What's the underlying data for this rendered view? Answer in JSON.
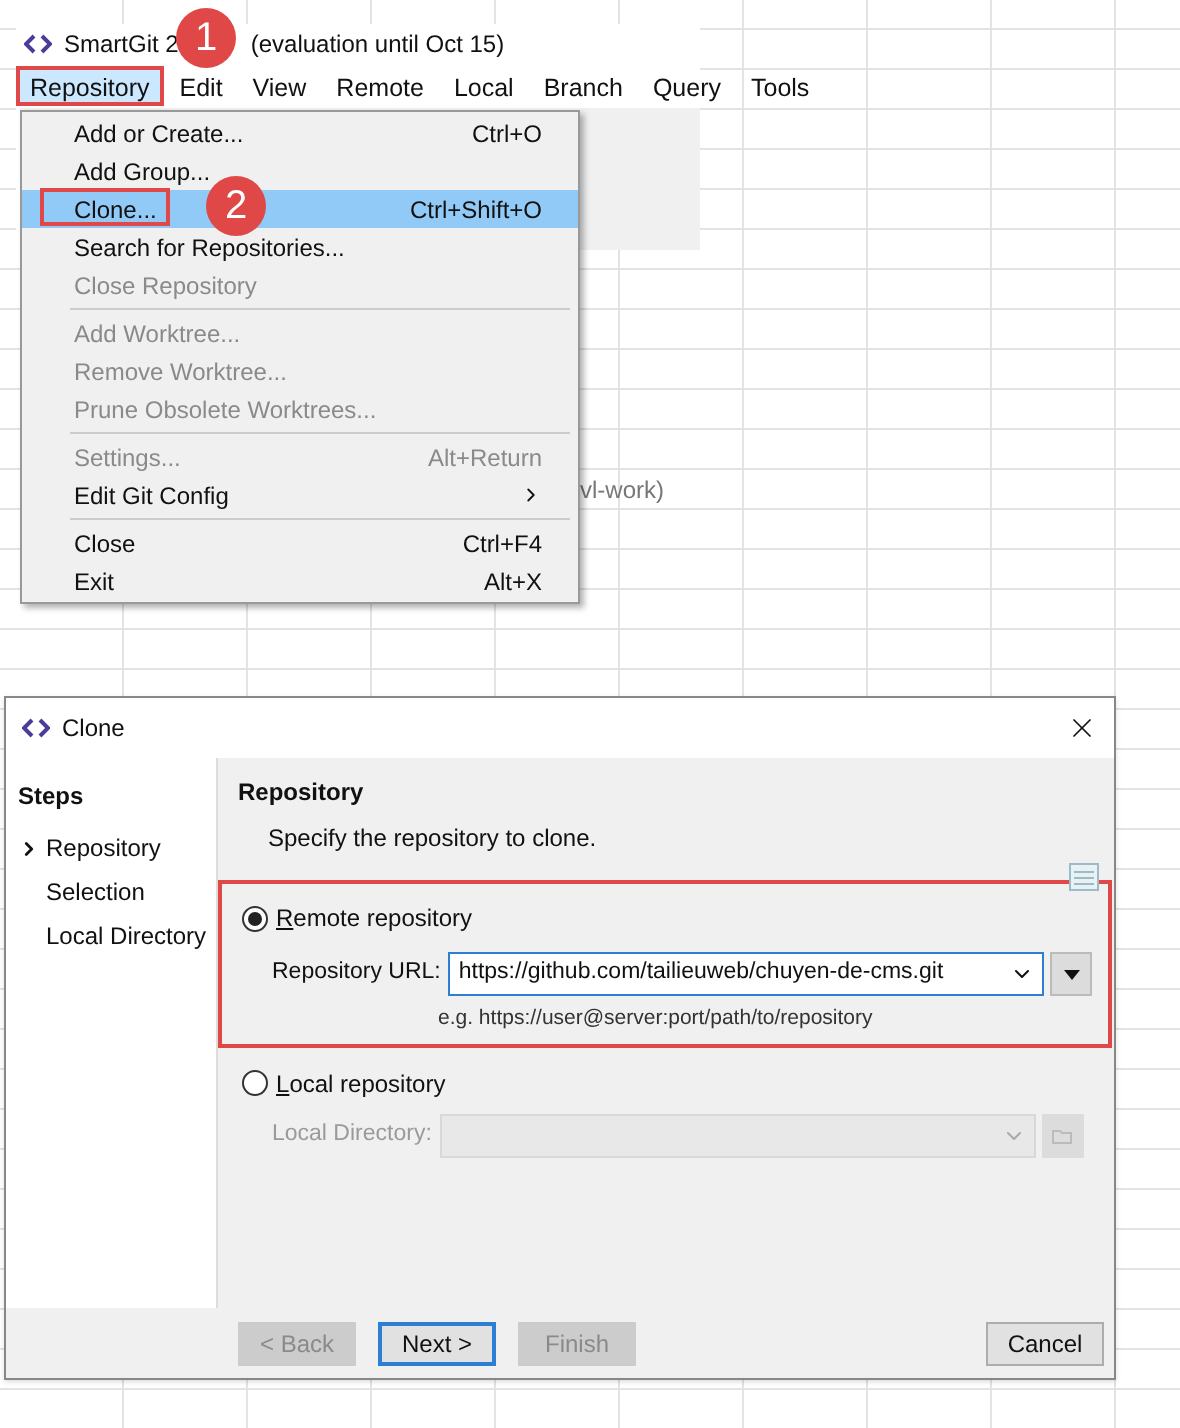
{
  "app_window": {
    "title": "SmartGit 2",
    "title_rest": "(evaluation until Oct 15)",
    "menu_bar": [
      {
        "label": "Repository",
        "selected": true
      },
      {
        "label": "Edit",
        "selected": false
      },
      {
        "label": "View",
        "selected": false
      },
      {
        "label": "Remote",
        "selected": false
      },
      {
        "label": "Local",
        "selected": false
      },
      {
        "label": "Branch",
        "selected": false
      },
      {
        "label": "Query",
        "selected": false
      },
      {
        "label": "Tools",
        "selected": false
      }
    ],
    "background_text": "vl-work)"
  },
  "menu": {
    "items": [
      {
        "kind": "item",
        "label": "Add or Create...",
        "shortcut": "Ctrl+O",
        "disabled": false,
        "selected": false
      },
      {
        "kind": "item",
        "label": "Add Group...",
        "disabled": false,
        "selected": false
      },
      {
        "kind": "item",
        "label": "Clone...",
        "shortcut": "Ctrl+Shift+O",
        "disabled": false,
        "selected": true
      },
      {
        "kind": "item",
        "label": "Search for Repositories...",
        "disabled": false,
        "selected": false
      },
      {
        "kind": "item",
        "label": "Close Repository",
        "disabled": true,
        "selected": false
      },
      {
        "kind": "separator"
      },
      {
        "kind": "item",
        "label": "Add Worktree...",
        "disabled": true,
        "selected": false
      },
      {
        "kind": "item",
        "label": "Remove Worktree...",
        "disabled": true,
        "selected": false
      },
      {
        "kind": "item",
        "label": "Prune Obsolete Worktrees...",
        "disabled": true,
        "selected": false
      },
      {
        "kind": "separator"
      },
      {
        "kind": "item",
        "label": "Settings...",
        "shortcut": "Alt+Return",
        "disabled": true,
        "selected": false
      },
      {
        "kind": "submenu",
        "label": "Edit Git Config",
        "disabled": false,
        "selected": false
      },
      {
        "kind": "separator"
      },
      {
        "kind": "item",
        "label": "Close",
        "shortcut": "Ctrl+F4",
        "disabled": false,
        "selected": false
      },
      {
        "kind": "item",
        "label": "Exit",
        "shortcut": "Alt+X",
        "disabled": false,
        "selected": false
      }
    ]
  },
  "callouts": [
    {
      "number": "1"
    },
    {
      "number": "2"
    }
  ],
  "dialog": {
    "title": "Clone",
    "steps_heading": "Steps",
    "steps": [
      {
        "label": "Repository",
        "selected": true
      },
      {
        "label": "Selection",
        "selected": false
      },
      {
        "label": "Local Directory",
        "selected": false
      }
    ],
    "section_title": "Repository",
    "description": "Specify the repository to clone.",
    "remote": {
      "label": "Remote repository",
      "selected": true,
      "field_label": "Repository URL:",
      "value": "https://github.com/tailieuweb/chuyen-de-cms.git",
      "hint": "e.g. https://user@server:port/path/to/repository"
    },
    "local": {
      "label": "Local repository",
      "selected": false,
      "field_label": "Local Directory:",
      "disabled": true
    },
    "buttons": [
      {
        "label": "< Back",
        "disabled": true,
        "default": false
      },
      {
        "label": "Next >",
        "disabled": false,
        "default": true
      },
      {
        "label": "Finish",
        "disabled": true,
        "default": false
      },
      {
        "label": "Cancel",
        "disabled": false,
        "default": false
      }
    ]
  }
}
